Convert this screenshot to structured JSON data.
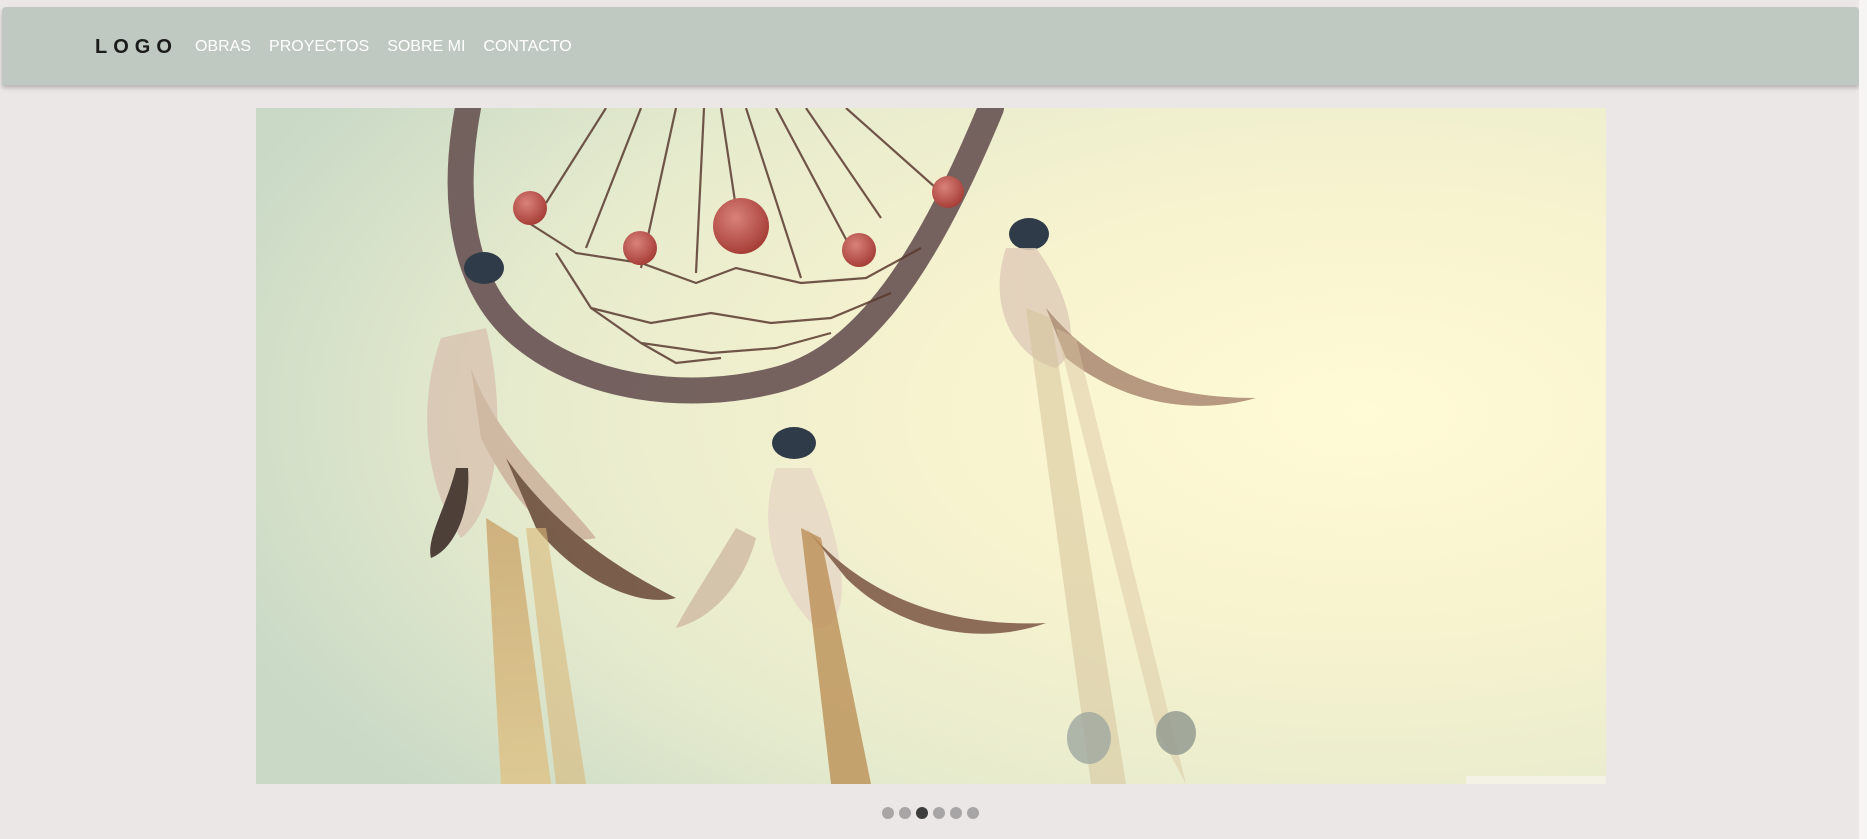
{
  "header": {
    "logo": "LOGO",
    "nav": [
      {
        "label": "OBRAS"
      },
      {
        "label": "PROYECTOS"
      },
      {
        "label": "SOBRE MI"
      },
      {
        "label": "CONTACTO"
      }
    ]
  },
  "carousel": {
    "image_subject": "dreamcatcher-against-sunlit-sky",
    "slide_count": 6,
    "active_index": 2
  },
  "colors": {
    "navbar": "#bfc9c2",
    "page_background": "#ebe7e6",
    "nav_text": "#ffffff",
    "logo_text": "#1b1b1b",
    "dot_inactive": "#a7a5a5",
    "dot_active": "#3d3d3d"
  }
}
